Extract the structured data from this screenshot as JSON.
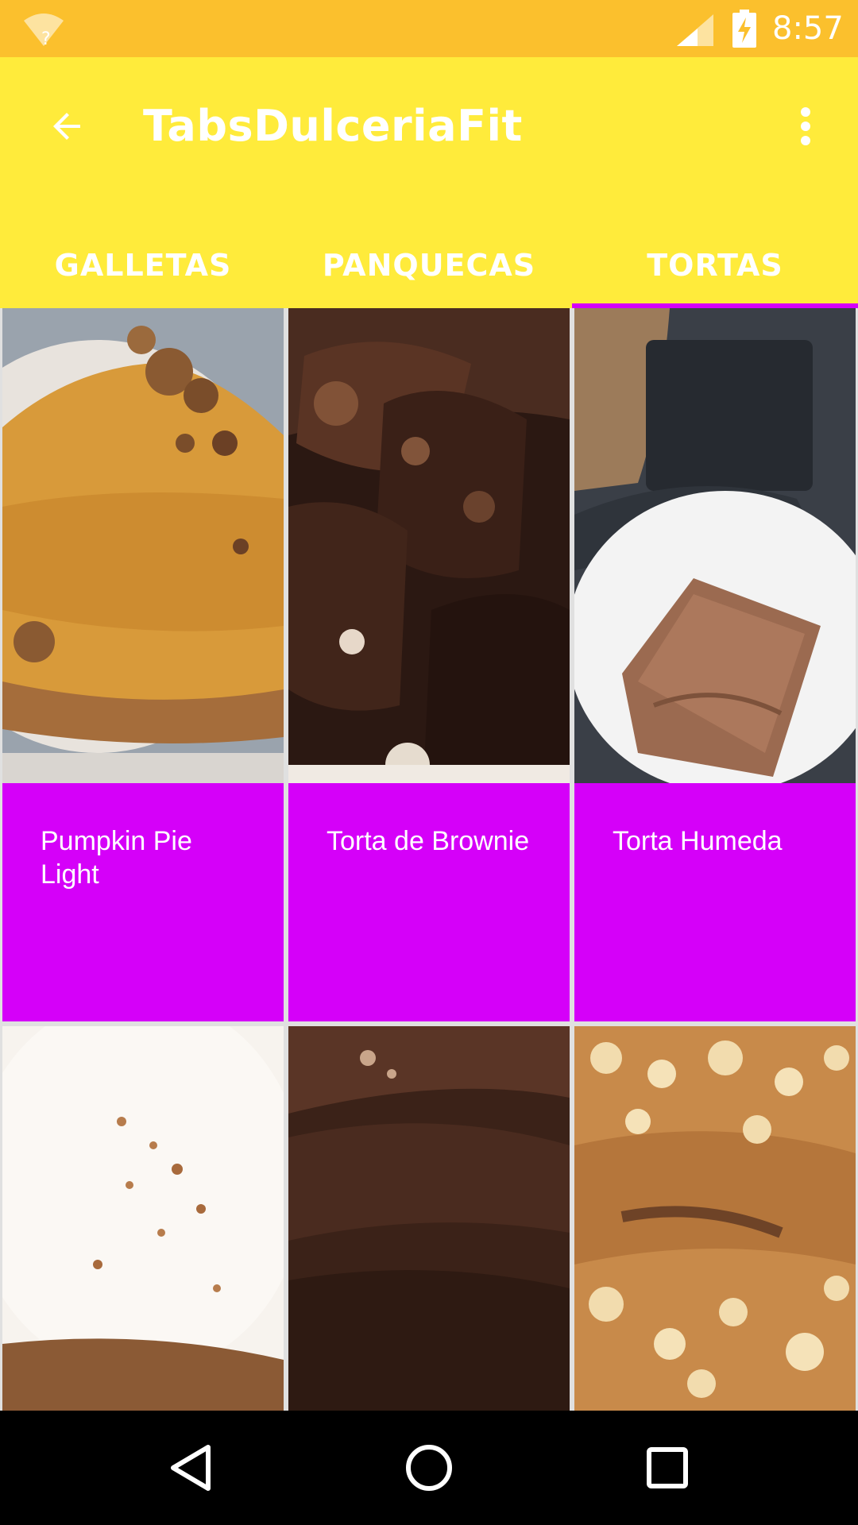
{
  "status_bar": {
    "time": "8:57",
    "icons": [
      "wifi-unknown-icon",
      "signal-icon",
      "battery-charging-icon"
    ]
  },
  "app_bar": {
    "title": "TabsDulceriaFit",
    "back_icon": "arrow-back-icon",
    "menu_icon": "more-vert-icon",
    "background": "#ffeb3b"
  },
  "tabs": [
    {
      "label": "GALLETAS",
      "selected": false
    },
    {
      "label": "PANQUECAS",
      "selected": false
    },
    {
      "label": "TORTAS",
      "selected": true
    }
  ],
  "accent_color": "#d500f9",
  "recipes": [
    {
      "name": "Pumpkin Pie Light",
      "image": "pumpkin-pie-photo"
    },
    {
      "name": "Torta de Brownie",
      "image": "brownie-cake-photo"
    },
    {
      "name": "Torta Humeda",
      "image": "moist-cake-photo"
    },
    {
      "name": "",
      "image": "cream-cinnamon-cake-photo"
    },
    {
      "name": "",
      "image": "chocolate-cake-photo"
    },
    {
      "name": "",
      "image": "carrot-nut-cake-photo"
    }
  ],
  "nav_bar": {
    "icons": [
      "back-triangle-icon",
      "home-circle-icon",
      "recents-square-icon"
    ]
  }
}
